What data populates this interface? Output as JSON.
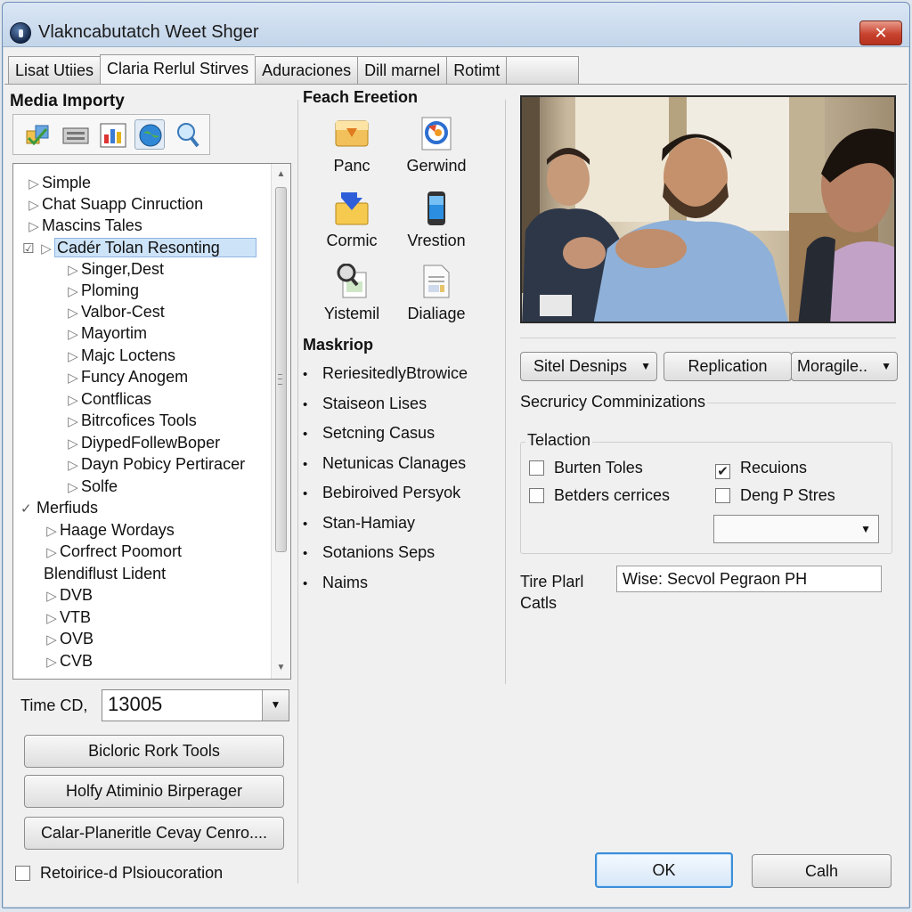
{
  "window": {
    "title": "Vlakncabutatch Weet Shger",
    "close_label": "✕"
  },
  "tabs": [
    {
      "label": "Lisat Utiies"
    },
    {
      "label": "Claria Rerlul Stirves"
    },
    {
      "label": "Aduraciones"
    },
    {
      "label": "Dill marnel"
    },
    {
      "label": "Rotimt"
    }
  ],
  "left": {
    "heading": "Media Importy",
    "toolbar_icons": [
      "import-icon",
      "scanner-icon",
      "chart-icon",
      "globe-icon",
      "magnifier-icon"
    ],
    "tree": [
      {
        "label": "Simple"
      },
      {
        "label": "Chat Suapp Cinruction"
      },
      {
        "label": "Mascins Tales"
      },
      {
        "label": "Cadér Tolan Resonting",
        "checked": "☑"
      },
      {
        "label": "Singer,Dest"
      },
      {
        "label": "Ploming"
      },
      {
        "label": "Valbor-Cest"
      },
      {
        "label": "Mayortim"
      },
      {
        "label": "Majc Loctens"
      },
      {
        "label": "Funcy Anogem"
      },
      {
        "label": "Contflicas"
      },
      {
        "label": "Bitrcofices Tools"
      },
      {
        "label": "DiypedFollewBoper"
      },
      {
        "label": "Dayn Pobicy Pertiracer"
      },
      {
        "label": "Solfe"
      },
      {
        "label": "Merfiuds",
        "checked": "✓"
      },
      {
        "label": "Haage Wordays"
      },
      {
        "label": "Corfrect Poomort"
      },
      {
        "label": "Blendiflust Lident"
      },
      {
        "label": "DVB"
      },
      {
        "label": "VTB"
      },
      {
        "label": "OVB"
      },
      {
        "label": "CVB"
      }
    ],
    "time_label": "Time CD,",
    "time_value": "13005",
    "buttons": [
      "Bicloric Rork Tools",
      "Holfy Atiminio Birperager",
      "Calar-Planeritle Cevay Cenro...."
    ],
    "checkbox_label": "Retoirice-d Plsioucoration"
  },
  "middle": {
    "heading": "Feach Ereetion",
    "icons": [
      {
        "label": "Panc",
        "icon": "download-folder-icon"
      },
      {
        "label": "Gerwind",
        "icon": "refresh-icon"
      },
      {
        "label": "Cormic",
        "icon": "folder-arrow-icon"
      },
      {
        "label": "Vrestion",
        "icon": "phone-icon"
      },
      {
        "label": "Yistemil",
        "icon": "search-doc-icon"
      },
      {
        "label": "Dialiage",
        "icon": "document-icon"
      }
    ],
    "list_heading": "Maskriop",
    "list": [
      "ReriesitedlyBtrowice",
      "Staiseon Lises",
      "Setcning Casus",
      "Netunicas Clanages",
      "Bebiroived Persyok",
      "Stan-Hamiay",
      "Sotanions Seps",
      "Naims"
    ]
  },
  "right": {
    "video_label": "video-meeting-image",
    "dropdown1": "Sitel Desnips",
    "button_replication": "Replication",
    "dropdown2": "Moragile..",
    "section_title": "Secruricy Comminizations",
    "group_title": "Telaction",
    "checkboxes": [
      {
        "label": "Burten Toles",
        "checked": false
      },
      {
        "label": "Recuions",
        "checked": true
      },
      {
        "label": "Betders cerrices",
        "checked": false
      },
      {
        "label": "Deng P Stres",
        "checked": false
      }
    ],
    "field_label_1": "Tire Plarl",
    "field_label_2": "Catls",
    "field_value": "Wise: Secvol Pegraon PH"
  },
  "footer": {
    "ok_label": "OK",
    "cancel_label": "Calh"
  },
  "colors": {
    "selection": "#cde3f8",
    "ok_border": "#3d8ed8",
    "close_button": "#c8432e"
  }
}
